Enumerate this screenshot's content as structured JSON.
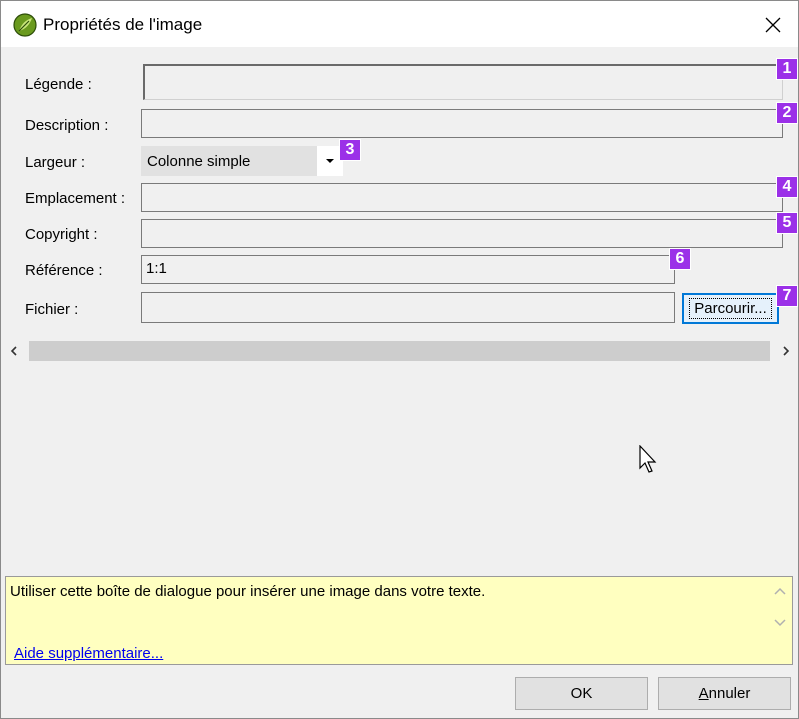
{
  "window": {
    "title": "Propriétés de l'image",
    "close_glyph": "✕"
  },
  "form": {
    "caption_label": "Légende :",
    "caption_value": "",
    "description_label": "Description :",
    "description_value": "",
    "width_label": "Largeur :",
    "width_value": "Colonne simple",
    "location_label": "Emplacement :",
    "location_value": "",
    "copyright_label": "Copyright :",
    "copyright_value": "",
    "reference_label": "Référence :",
    "reference_value": "1:1",
    "file_label": "Fichier :",
    "file_value": "",
    "browse_label": "Parcourir..."
  },
  "badges": [
    "1",
    "2",
    "3",
    "4",
    "5",
    "6",
    "7"
  ],
  "badge_color": "#9b30e8",
  "scrollbar": {
    "left_glyph": "<",
    "right_glyph": ">"
  },
  "help": {
    "text": "Utiliser cette boîte de dialogue pour insérer une image dans votre texte.",
    "link": "Aide supplémentaire..."
  },
  "footer": {
    "ok_label": "OK",
    "cancel_label": "Annuler"
  },
  "icons": {
    "app": "leaf-logo-icon",
    "close": "close-icon",
    "dropdown": "dropdown-arrow-icon",
    "cursor": "mouse-pointer-icon"
  }
}
